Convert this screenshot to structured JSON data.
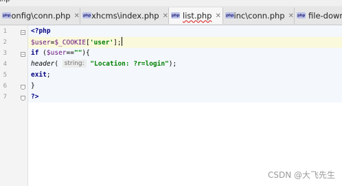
{
  "breadcrumb": {
    "text": "ihp"
  },
  "tabs": [
    {
      "icon": "php-file-icon",
      "icon_text": "php",
      "label": "config\\conn.php"
    },
    {
      "icon": "php-file-icon",
      "icon_text": "php",
      "label": "xhcms\\index.php"
    },
    {
      "icon": "php-file-icon",
      "icon_text": "php",
      "label": "list.php"
    },
    {
      "icon": "php-file-icon",
      "icon_text": "php",
      "label": "inc\\conn.php"
    },
    {
      "icon": "php-file-icon",
      "icon_text": "php",
      "label": "file-down"
    }
  ],
  "editor": {
    "line_numbers": [
      "1",
      "2",
      "3",
      "4",
      "5",
      "6",
      "7"
    ],
    "lines": {
      "l1_open": "<?php",
      "l2_var": "$user",
      "l2_eq": "=",
      "l2_cookie": "$_COOKIE",
      "l2_open": "[",
      "l2_key": "'user'",
      "l2_close": "];",
      "l3_if": "if",
      "l3_open": " (",
      "l3_var": "$user",
      "l3_eq": "==",
      "l3_str": "\"\"",
      "l3_close": "){",
      "l4_fn": "header",
      "l4_paren": "(",
      "l4_hint": "string:",
      "l4_str": "\"Location: ?r=login\"",
      "l4_end": ");",
      "l5_exit": "exit",
      "l5_semi": ";",
      "l6_brace": "}",
      "l7_close": "?>"
    }
  },
  "watermark": "CSDN @大飞先生",
  "colors": {
    "keyword": "#000080",
    "variable": "#660e7a",
    "string": "#008000",
    "current_line": "#fbf9dc",
    "php_block": "#f4f8fd"
  }
}
